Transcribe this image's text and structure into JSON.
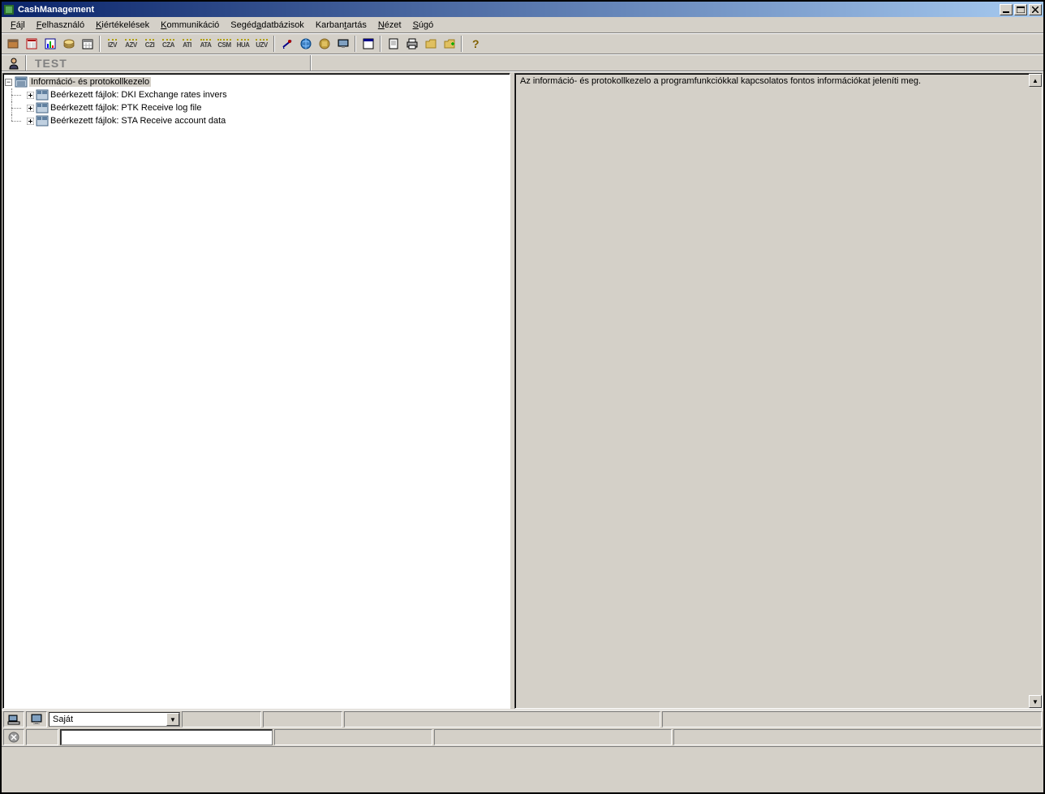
{
  "title": "CashManagement",
  "menu": {
    "items": [
      {
        "label": "Fájl",
        "accel": 0
      },
      {
        "label": "Felhasználó",
        "accel": 0
      },
      {
        "label": "Kiértékelések",
        "accel": 0
      },
      {
        "label": "Kommunikáció",
        "accel": 0
      },
      {
        "label": "Segédadatbázisok",
        "accel": 5
      },
      {
        "label": "Karbantartás",
        "accel": 6
      },
      {
        "label": "Nézet",
        "accel": 0
      },
      {
        "label": "Súgó",
        "accel": 0
      }
    ]
  },
  "toolbar": {
    "labels": [
      "IZV",
      "AZV",
      "CZI",
      "CZA",
      "ATI",
      "ATA",
      "CSM",
      "HUA",
      "UZV"
    ]
  },
  "infobar": {
    "text": "TEST"
  },
  "tree": {
    "root": "Információ- és protokollkezelo",
    "children": [
      "Beérkezett fájlok: DKI Exchange rates invers",
      "Beérkezett fájlok: PTK Receive log file",
      "Beérkezett fájlok: STA Receive account data"
    ]
  },
  "info_panel": {
    "text": "Az információ- és protokollkezelo a programfunkciókkal kapcsolatos fontos információkat jeleníti meg."
  },
  "status": {
    "combo_value": "Saját"
  }
}
